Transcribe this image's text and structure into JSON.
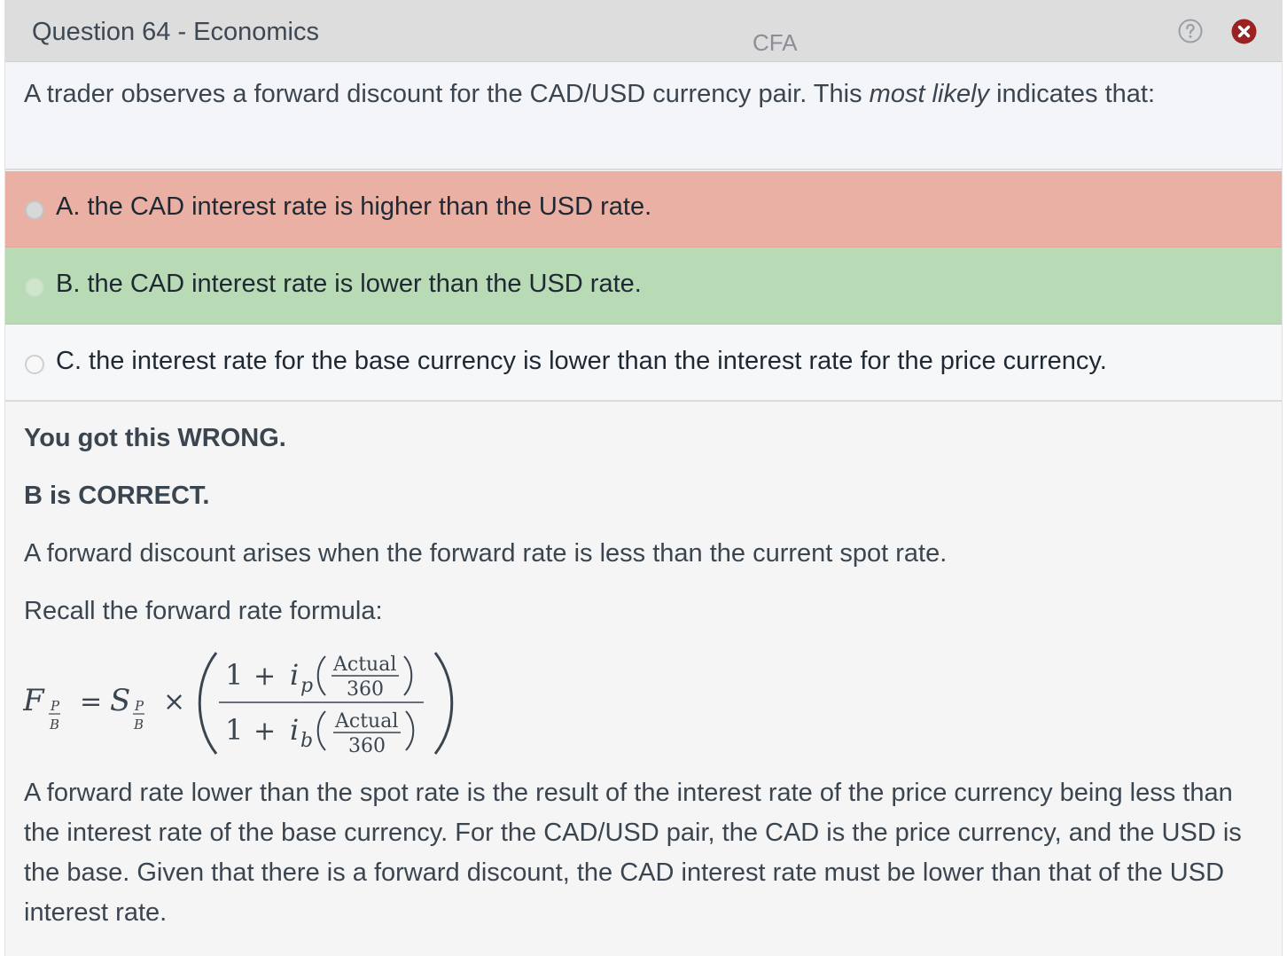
{
  "header": {
    "title": "Question 64 - Economics",
    "tag": "CFA"
  },
  "icons": {
    "help": "help-icon",
    "close": "close-icon",
    "close_color": "#9a2222"
  },
  "question": {
    "text_before": "A trader observes a forward discount for the CAD/USD currency pair.  This ",
    "emphasis": "most likely",
    "text_after": " indicates that:"
  },
  "options": [
    {
      "label": "A. the CAD interest rate is higher than the USD rate.",
      "state": "selected-wrong",
      "color": "#ebb0a4"
    },
    {
      "label": "B. the CAD interest rate is lower than the USD rate.",
      "state": "correct",
      "color": "#b8dab5"
    },
    {
      "label": "C. the interest rate for the base currency is lower than the interest rate for the price currency.",
      "state": "neutral",
      "color": "#f6f7f9"
    }
  ],
  "explanation": {
    "result": "You got this WRONG.",
    "correct": "B is CORRECT.",
    "p1": "A forward discount arises when the forward rate is less than the current spot rate.",
    "p2": "Recall the forward rate formula:",
    "formula": {
      "F": "F",
      "S": "S",
      "equals": "=",
      "times": "×",
      "one": "1",
      "plus": "+",
      "i": "i",
      "sub_p": "p",
      "sub_b": "b",
      "frac_P": "P",
      "frac_B": "B",
      "actual": "Actual",
      "days": "360"
    },
    "p3": "A forward rate lower than the spot rate is the result of the interest rate of the price currency being less than the interest rate of the base currency.  For the CAD/USD pair, the CAD is the price currency, and the USD is the base.  Given that there is a forward discount, the CAD interest rate must be lower than that of the USD interest rate."
  }
}
